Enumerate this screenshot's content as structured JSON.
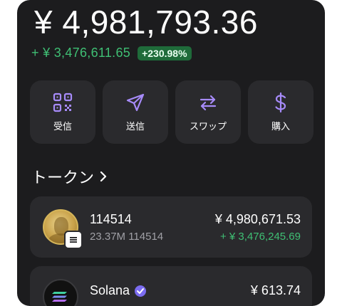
{
  "wallet": {
    "balance": "¥ 4,981,793.36",
    "change_amount": "+ ¥ 3,476,611.65",
    "change_percent": "+230.98%"
  },
  "actions": [
    {
      "label": "受信",
      "icon": "qr-code-icon"
    },
    {
      "label": "送信",
      "icon": "send-icon"
    },
    {
      "label": "スワップ",
      "icon": "swap-icon"
    },
    {
      "label": "購入",
      "icon": "dollar-icon"
    }
  ],
  "tokens_section": {
    "title": "トークン"
  },
  "tokens": [
    {
      "name": "114514",
      "amount": "23.37M 114514",
      "value": "¥ 4,980,671.53",
      "change": "+ ¥ 3,476,245.69"
    },
    {
      "name": "Solana",
      "value": "¥ 613.74"
    }
  ],
  "colors": {
    "accent_purple": "#a78bfa",
    "positive_green": "#3fbf74",
    "badge_green": "#1f6b3a",
    "card_bg": "#2a2a2d",
    "panel_bg": "#1c1c1e"
  }
}
